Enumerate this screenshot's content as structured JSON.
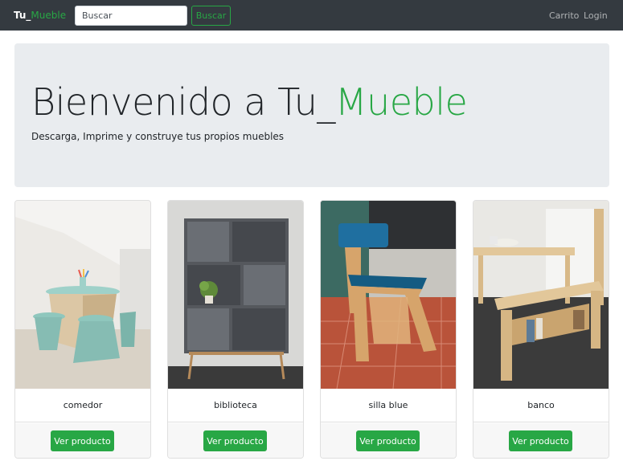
{
  "navbar": {
    "brand_prefix": "Tu_",
    "brand_accent": "Mueble",
    "search_placeholder": "Buscar",
    "search_button": "Buscar",
    "links": [
      "Carrito",
      "Login"
    ]
  },
  "hero": {
    "title_prefix": "Bienvenido a Tu_",
    "title_accent": "Mueble",
    "subtitle": "Descarga, Imprime y construye tus propios muebles"
  },
  "products": [
    {
      "name": "comedor",
      "button": "Ver producto"
    },
    {
      "name": "biblioteca",
      "button": "Ver producto"
    },
    {
      "name": "silla blue",
      "button": "Ver producto"
    },
    {
      "name": "banco",
      "button": "Ver producto"
    }
  ],
  "colors": {
    "navbar_bg": "#343a40",
    "accent": "#28a745",
    "hero_bg": "#e9ecef"
  }
}
